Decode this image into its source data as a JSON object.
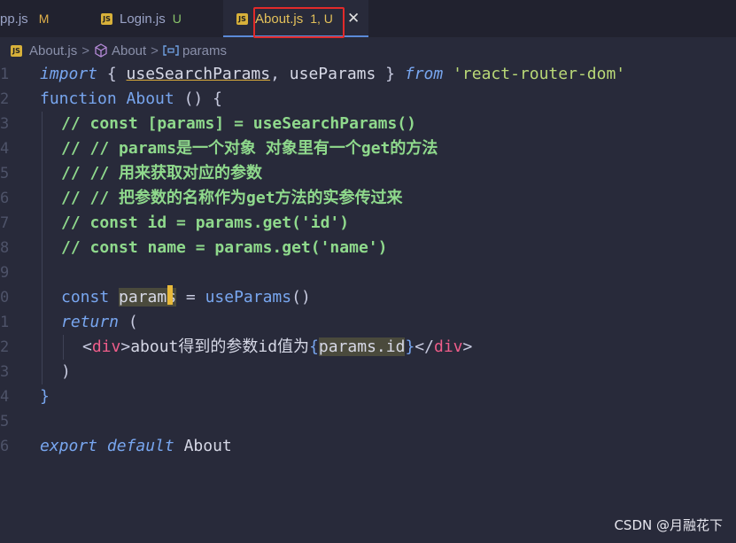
{
  "tabs": [
    {
      "name": "pp.js",
      "badge": "M",
      "active": false
    },
    {
      "name": "Login.js",
      "badge": "U",
      "active": false
    },
    {
      "name": "About.js",
      "badge": "1, U",
      "active": true
    }
  ],
  "tab_icon_text": "JS",
  "close_glyph": "✕",
  "breadcrumb": {
    "file": "About.js",
    "component": "About",
    "symbol": "params",
    "separator": ">"
  },
  "line_numbers": [
    "1",
    "2",
    "3",
    "4",
    "5",
    "6",
    "7",
    "8",
    "9",
    "0",
    "1",
    "2",
    "3",
    "4",
    "5",
    "6"
  ],
  "code": {
    "l1": {
      "import": "import",
      "open": " { ",
      "useSearchParams": "useSearchParams",
      "comma": ", ",
      "useParams": "useParams",
      "close": " } ",
      "from": "from",
      "module": "'react-router-dom'"
    },
    "l2": {
      "function": "function",
      "name": "About",
      "rest": " () {"
    },
    "l3": "// const [params] = useSearchParams()",
    "l4": "// // params是一个对象 对象里有一个get的方法",
    "l5": "// // 用来获取对应的参数",
    "l6": "// // 把参数的名称作为get方法的实参传过来",
    "l7": "// const id = params.get('id')",
    "l8": "// const name = params.get('name')",
    "l10": {
      "const": "const",
      "var": "params",
      "eq": " = ",
      "fn": "useParams",
      "call": "()"
    },
    "l11": {
      "return": "return",
      "paren": " ("
    },
    "l12": {
      "lt": "<",
      "tag": "div",
      "gt": ">",
      "text": "about得到的参数id值为",
      "lb": "{",
      "expr": "params.id",
      "rb": "}",
      "lt2": "</",
      "tag2": "div",
      "gt2": ">"
    },
    "l13": ")",
    "l14": "}",
    "l16": {
      "export": "export",
      "default": "default",
      "name": "About"
    }
  },
  "watermark": "CSDN @月融花下",
  "colors": {
    "background": "#282a3a",
    "keyword": "#78a6ef",
    "string": "#b9d877",
    "comment": "#8fd98c",
    "tag": "#ef5d8a",
    "active_tab": "#e3c05a",
    "highlight_box": "#e12a2a"
  }
}
